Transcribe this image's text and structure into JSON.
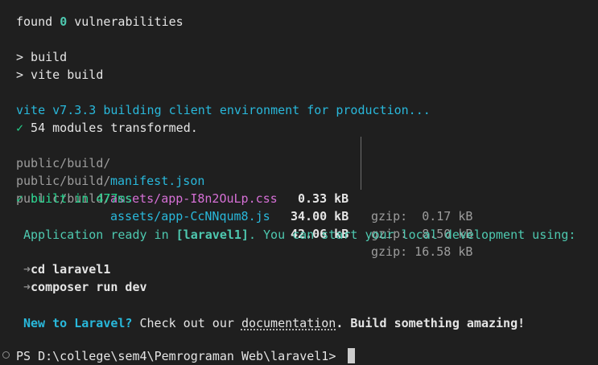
{
  "audit": {
    "prefix": "found ",
    "count": "0",
    "suffix": " vulnerabilities"
  },
  "scripts": {
    "line1": "> build",
    "line2": "> vite build"
  },
  "vite": {
    "header": "vite v7.3.3 building client environment for production...",
    "check": "✓",
    "modules": " 54 modules transformed.",
    "files": [
      {
        "dir": "public/build/",
        "name": "manifest.json",
        "size": "0.33 kB",
        "gzip": "gzip:  0.17 kB",
        "color": "#29b8db"
      },
      {
        "dir": "public/build/",
        "name": "assets/app-I8n2OuLp.css",
        "size": "34.00 kB",
        "gzip": "gzip:  8.50 kB",
        "color": "#d670d6"
      },
      {
        "dir": "public/build/",
        "name": "assets/app-CcNNqum8.js",
        "size": "42.06 kB",
        "gzip": "gzip: 16.58 kB",
        "color": "#29b8db"
      }
    ],
    "built": " built in 477ms"
  },
  "ready": {
    "prefix": "Application ready in ",
    "app": "[laravel1]",
    "suffix": ". You can start your local development using:"
  },
  "commands": [
    {
      "arrow": "➜",
      "text": "cd laravel1"
    },
    {
      "arrow": "➜",
      "text": "composer run dev"
    }
  ],
  "footer": {
    "new_label": "New to Laravel?",
    "check_out": " Check out our ",
    "docs_link": "documentation",
    "tail": ". Build something amazing!"
  },
  "prompt": {
    "text": "PS D:\\college\\sem4\\Pemrograman Web\\laravel1> "
  }
}
